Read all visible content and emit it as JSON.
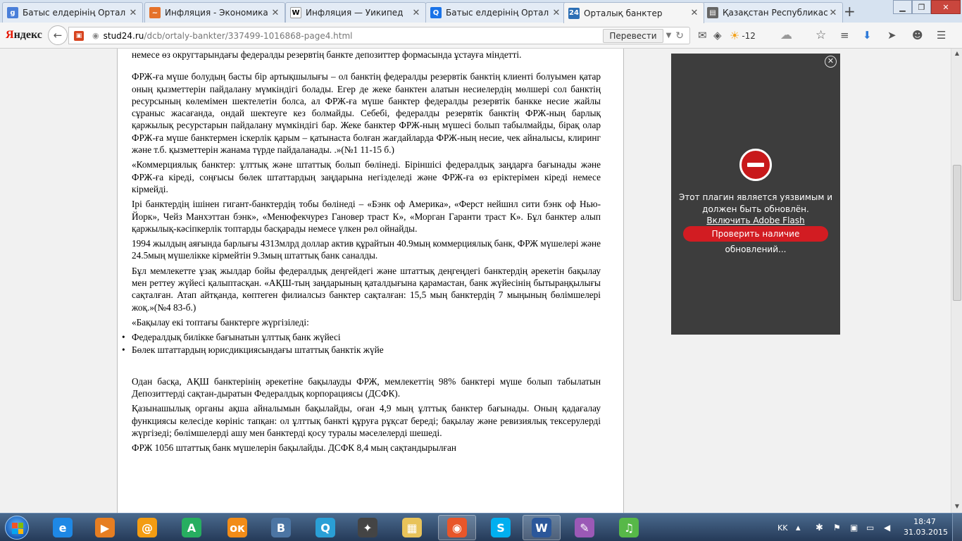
{
  "browser": {
    "tabs": [
      {
        "label": "Батыс елдерінің Ортал",
        "icon": "google-icon",
        "color": "#4a7fd9",
        "glyph": "g"
      },
      {
        "label": "Инфляция - Экономика",
        "icon": "chart-icon",
        "color": "#e5722a",
        "glyph": "~"
      },
      {
        "label": "Инфляция — Уикипед",
        "icon": "wikipedia-icon",
        "color": "#ffffff",
        "glyph": "W"
      },
      {
        "label": "Батыс елдерінің Ортал",
        "icon": "search-icon",
        "color": "#1a73e8",
        "glyph": "Q"
      },
      {
        "label": "Орталық банктер",
        "icon": "site-icon",
        "color": "#2d6fb5",
        "glyph": "24"
      },
      {
        "label": "Қазақстан Республикас",
        "icon": "document-icon",
        "color": "#666666",
        "glyph": "▤"
      }
    ],
    "new_tab": "+",
    "yandex_logo_red": "Я",
    "yandex_logo_rest": "ндекс",
    "url_host": "stud24.ru",
    "url_path": "/dcb/ortaly-bankter/337499-1016868-page4.html",
    "translate_label": "Перевести",
    "weather_temp": "-12"
  },
  "document": {
    "paragraphs": [
      "немесе өз округтарындағы федералды резервтің банкте депозиттер формасында ұстауға міндетті.",
      "ФРЖ-ға мүше болудың басты бір артықшылығы – ол банктің федералды резервтік банктің клиенті болуымен қатар оның қызметтерін пайдалану мүмкіндігі болады. Егер де жеке банктен алатын несиелердің мөлшері сол банктің ресурсының көлемімен шектелетін болса, ал ФРЖ-ға мүше банктер федералды резервтік банкке несие жайлы сұраныс жасағанда, ондай шектеуге кез болмайды. Себебі, федералды резервтік банктің ФРЖ-ның барлық қаржылық ресурстарын пайдалану мүмкіндігі бар. Жеке банктер ФРЖ-ның мүшесі болып табылмайды, бірақ олар ФРЖ-ға мүше банктермен іскерлік қарым – қатынаста болған жағдайларда ФРЖ-ның несие, чек айналысы, клиринг және т.б. қызметтерін жанама түрде пайдаланады. .»(№1 11-15 б.)",
      "«Коммерциялық банктер: ұлттық және штаттық болып бөлінеді. Біріншісі федералдық заңдарға бағынады және ФРЖ-ға кіреді, соңғысы бөлек штаттардың заңдарына негізделеді және ФРЖ-ға өз еріктерімен кіреді немесе кірмейді.",
      "Ірі банктердің ішінен гигант-банктердің тобы бөлінеді – «Бэнк оф Америка», «Ферст нейшнл сити бэнк оф Нью-Йорк», Чейз Манхэттан бэнк», «Менюфекчурез Гановер траст К», «Морган Гаранти траст К». Бұл банктер алып қаржылық-кәсіпкерлік топтарды басқарады немесе үлкен рөл ойнайды.",
      "1994 жылдың аяғында барлығы 4313млрд доллар актив құрайтын 40.9мың коммерциялық банк, ФРЖ мүшелері және 24.5мың мүшелікке кірмейтін 9.3мың штаттық банк саналды.",
      "Бұл мемлекетте ұзақ жылдар бойы федералдық деңгейдегі және штаттық деңгеңдегі банктердің әрекетін бақылау мен реттеу жүйесі қалыптасқан. «АҚШ-тың заңдарының қаталдығына қарамастан, банк жүйесінің бытыраңқылығы сақталған. Атап айтқанда, көптеген филиалсыз банктер сақталған: 15,5 мың банктердің 7 мыңының бөлімшелері жоқ.»(№4 83-б.)",
      "«Бақылау екі топтағы банктерге жүргізіледі:"
    ],
    "bullets": [
      "Федералдық билікке бағынатын ұлттық банк жүйесі",
      "Бөлек штаттардың юрисдикциясындағы штаттық банктік жүйе"
    ],
    "bullet_glyph": "•",
    "paragraphs_after": [
      "Одан басқа, АҚШ банктерінің әрекетіне бақылауды ФРЖ, мемлекеттің 98% банктері мүше болып табылатын Депозиттерді сақтан-дыратын Федералдық корпорациясы (ДСФК).",
      "Қазынашылық органы ақша айналымын бақылайды, оған 4,9 мың ұлттық банктер бағынады. Оның қадағалау функциясы келесіде көрініс тапқан: ол ұлттық банкті құруға рұқсат береді; бақылау және ревизиялық тексерулерді жүргізеді; бөлімшелерді ашу мен банктерді қосу туралы мәселелерді шешеді.",
      "ФРЖ 1056 штаттық банк мүшелерін бақылайды. ДСФК 8,4 мың сақтандырылған"
    ]
  },
  "flash": {
    "message_line1": "Этот плагин является уязвимым и",
    "message_line2": "должен быть обновлён.",
    "enable_link": "Включить Adobe Flash",
    "check_button": "Проверить наличие обновлений..."
  },
  "taskbar": {
    "apps": [
      {
        "name": "internet-explorer-icon",
        "color": "#1e88e5",
        "glyph": "e"
      },
      {
        "name": "media-player-icon",
        "color": "#e67e22",
        "glyph": "▶"
      },
      {
        "name": "mail-agent-icon",
        "color": "#f39c12",
        "glyph": "@"
      },
      {
        "name": "green-app-icon",
        "color": "#27ae60",
        "glyph": "A"
      },
      {
        "name": "odnoklassniki-icon",
        "color": "#f28c18",
        "glyph": "ок"
      },
      {
        "name": "vkontakte-icon",
        "color": "#4c75a3",
        "glyph": "B"
      },
      {
        "name": "qip-icon",
        "color": "#2a9fd6",
        "glyph": "Q"
      },
      {
        "name": "media-get-icon",
        "color": "#444444",
        "glyph": "✦"
      },
      {
        "name": "file-explorer-icon",
        "color": "#e8c35a",
        "glyph": "▦"
      },
      {
        "name": "firefox-icon",
        "color": "#e8562a",
        "glyph": "◉"
      },
      {
        "name": "skype-icon",
        "color": "#00aff0",
        "glyph": "S"
      },
      {
        "name": "word-icon",
        "color": "#2b579a",
        "glyph": "W"
      },
      {
        "name": "paint-icon",
        "color": "#9b59b6",
        "glyph": "✎"
      },
      {
        "name": "music-icon",
        "color": "#57b848",
        "glyph": "♫"
      }
    ],
    "language": "KK",
    "time": "18:47",
    "date": "31.03.2015"
  }
}
